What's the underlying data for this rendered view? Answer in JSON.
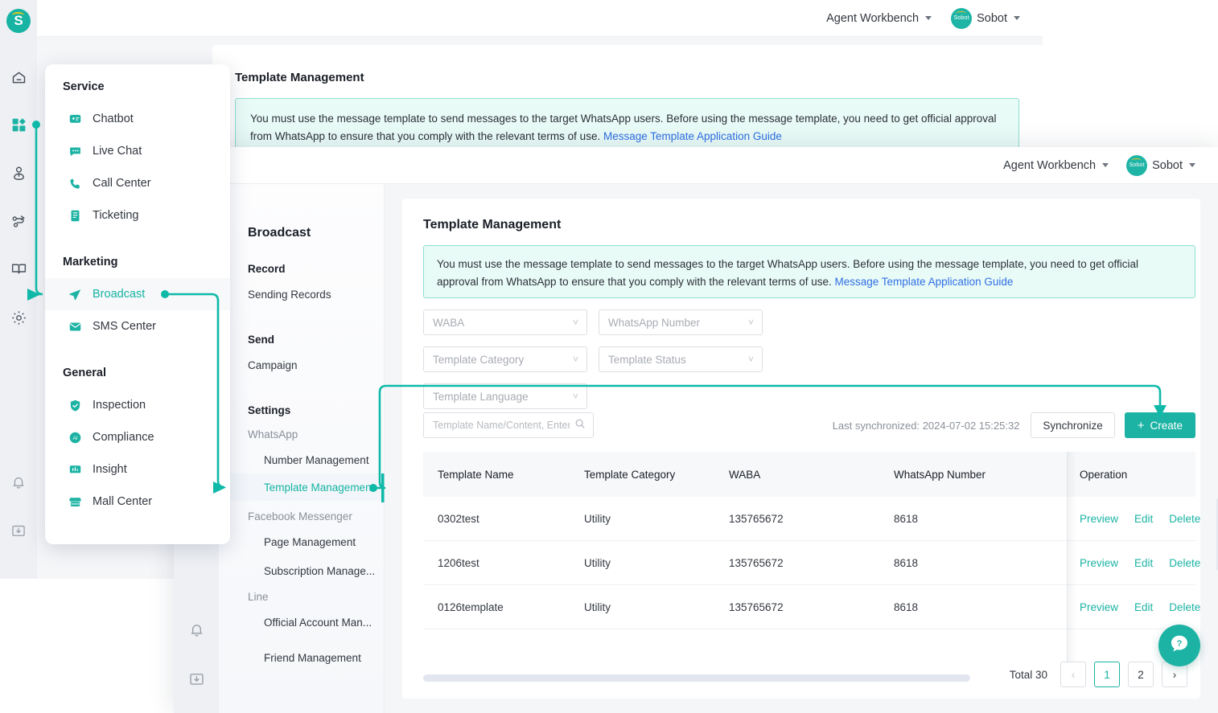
{
  "brand": {
    "accent": "#1cb3a4",
    "link": "#2f6fe4",
    "banner_bg": "#e9fbf7",
    "banner_border": "#8fded2",
    "logo_letter": "S"
  },
  "topbar": {
    "workbench_label": "Agent Workbench",
    "account_label": "Sobot",
    "avatar_label": "Sobot"
  },
  "flyout": {
    "groups": [
      {
        "title": "Service",
        "items": [
          {
            "label": "Chatbot",
            "icon": "chatbot-icon"
          },
          {
            "label": "Live Chat",
            "icon": "live-chat-icon"
          },
          {
            "label": "Call Center",
            "icon": "phone-icon"
          },
          {
            "label": "Ticketing",
            "icon": "ticket-icon"
          }
        ]
      },
      {
        "title": "Marketing",
        "items": [
          {
            "label": "Broadcast",
            "icon": "send-icon",
            "active": true
          },
          {
            "label": "SMS Center",
            "icon": "mail-icon"
          }
        ]
      },
      {
        "title": "General",
        "items": [
          {
            "label": "Inspection",
            "icon": "shield-check-icon"
          },
          {
            "label": "Compliance",
            "icon": "ai-badge-icon"
          },
          {
            "label": "Insight",
            "icon": "insight-icon"
          },
          {
            "label": "Mall Center",
            "icon": "store-icon"
          }
        ]
      }
    ]
  },
  "rail": {
    "icons": [
      "home-icon",
      "apps-icon",
      "contacts-icon",
      "flow-icon",
      "book-icon",
      "gear-icon"
    ],
    "bottom_icons": [
      "bell-icon",
      "download-folder-icon"
    ],
    "active_index": 1
  },
  "subnav": {
    "title": "Broadcast",
    "sections": [
      {
        "group": "Record",
        "items": [
          {
            "label": "Sending Records",
            "level": 1
          }
        ]
      },
      {
        "group": "Send",
        "items": [
          {
            "label": "Campaign",
            "level": 1
          }
        ]
      },
      {
        "group": "Settings",
        "items": []
      }
    ],
    "settings_subgroups": [
      {
        "label": "WhatsApp",
        "items": [
          {
            "label": "Number Management"
          },
          {
            "label": "Template Management",
            "active": true
          }
        ]
      },
      {
        "label": "Facebook Messenger",
        "items": [
          {
            "label": "Page Management"
          },
          {
            "label": "Subscription Manage..."
          }
        ]
      },
      {
        "label": "Line",
        "items": [
          {
            "label": "Official Account Man..."
          },
          {
            "label": "Friend Management"
          }
        ]
      }
    ]
  },
  "page": {
    "title": "Template Management",
    "banner_text": "You must use the message template to send messages to the target WhatsApp users. Before using the message template, you need to get official approval from WhatsApp to ensure that you comply with the relevant terms of use.",
    "banner_link": "Message Template Application Guide"
  },
  "filters": [
    {
      "name": "waba",
      "placeholder": "WABA"
    },
    {
      "name": "whatsapp-number",
      "placeholder": "WhatsApp Number"
    },
    {
      "name": "template-category",
      "placeholder": "Template Category"
    },
    {
      "name": "template-status",
      "placeholder": "Template Status"
    },
    {
      "name": "template-language",
      "placeholder": "Template Language"
    }
  ],
  "search": {
    "placeholder": "Template Name/Content, Enter to search",
    "value": "",
    "icon": "search-icon"
  },
  "actions": {
    "last_synchronized": "Last synchronized: 2024-07-02 15:25:32",
    "synchronize_label": "Synchronize",
    "create_label": "Create",
    "create_icon": "plus-icon"
  },
  "table": {
    "columns": [
      "Template Name",
      "Template Category",
      "WABA",
      "WhatsApp Number",
      "Operation"
    ],
    "rows": [
      {
        "name": "0302test",
        "category": "Utility",
        "waba": "135765672",
        "number": "8618"
      },
      {
        "name": "1206test",
        "category": "Utility",
        "waba": "135765672",
        "number": "8618"
      },
      {
        "name": "0126template",
        "category": "Utility",
        "waba": "135765672",
        "number": "8618"
      }
    ],
    "operations": [
      "Preview",
      "Edit",
      "Delete"
    ]
  },
  "pagination": {
    "total_label": "Total 30",
    "prev_icon": "chevron-left-icon",
    "next_icon": "chevron-right-icon",
    "pages": [
      "1",
      "2"
    ],
    "current": "1"
  },
  "help": {
    "icon": "question-bubble-icon"
  },
  "background_window": {
    "title": "Template Management",
    "banner_text": "You must use the message template to send messages to the target WhatsApp users. Before using the message template, you need to get official approval from WhatsApp to ensure that you comply with the relevant terms of use.",
    "banner_link": "Message Template Application Guide"
  }
}
